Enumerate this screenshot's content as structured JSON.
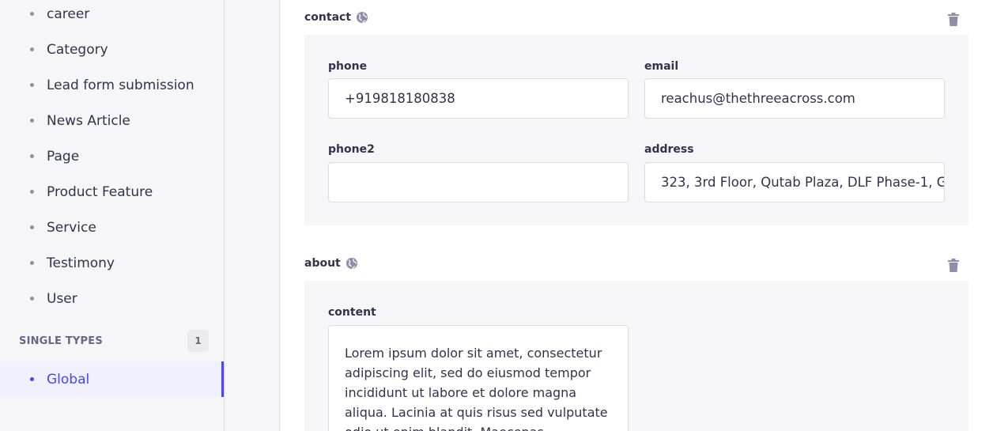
{
  "sidebar": {
    "collection_items": [
      {
        "label": "career"
      },
      {
        "label": "Category"
      },
      {
        "label": "Lead form submission"
      },
      {
        "label": "News Article"
      },
      {
        "label": "Page"
      },
      {
        "label": "Product Feature"
      },
      {
        "label": "Service"
      },
      {
        "label": "Testimony"
      },
      {
        "label": "User"
      }
    ],
    "single_types": {
      "title": "SINGLE TYPES",
      "count": "1",
      "items": [
        {
          "label": "Global"
        }
      ]
    }
  },
  "contact": {
    "title": "contact",
    "phone": {
      "label": "phone",
      "value": "+919818180838"
    },
    "email": {
      "label": "email",
      "value": "reachus@thethreeacross.com"
    },
    "phone2": {
      "label": "phone2",
      "value": ""
    },
    "address": {
      "label": "address",
      "value": "323, 3rd Floor, Qutab Plaza, DLF Phase-1, G"
    }
  },
  "about": {
    "title": "about",
    "content": {
      "label": "content",
      "value": "Lorem ipsum dolor sit amet, consectetur adipiscing elit, sed do eiusmod tempor incididunt ut labore et dolore magna aliqua. Lacinia at quis risus sed vulputate odio ut enim blandit. Maecenas accumsan lacus vel"
    }
  },
  "colors": {
    "accent": "#4945ff",
    "active_bg": "#f0f0ff",
    "panel_bg": "#f6f6f9",
    "icon_gray": "#8e8ea9"
  },
  "icons": [
    "globe-icon",
    "trash-icon"
  ]
}
